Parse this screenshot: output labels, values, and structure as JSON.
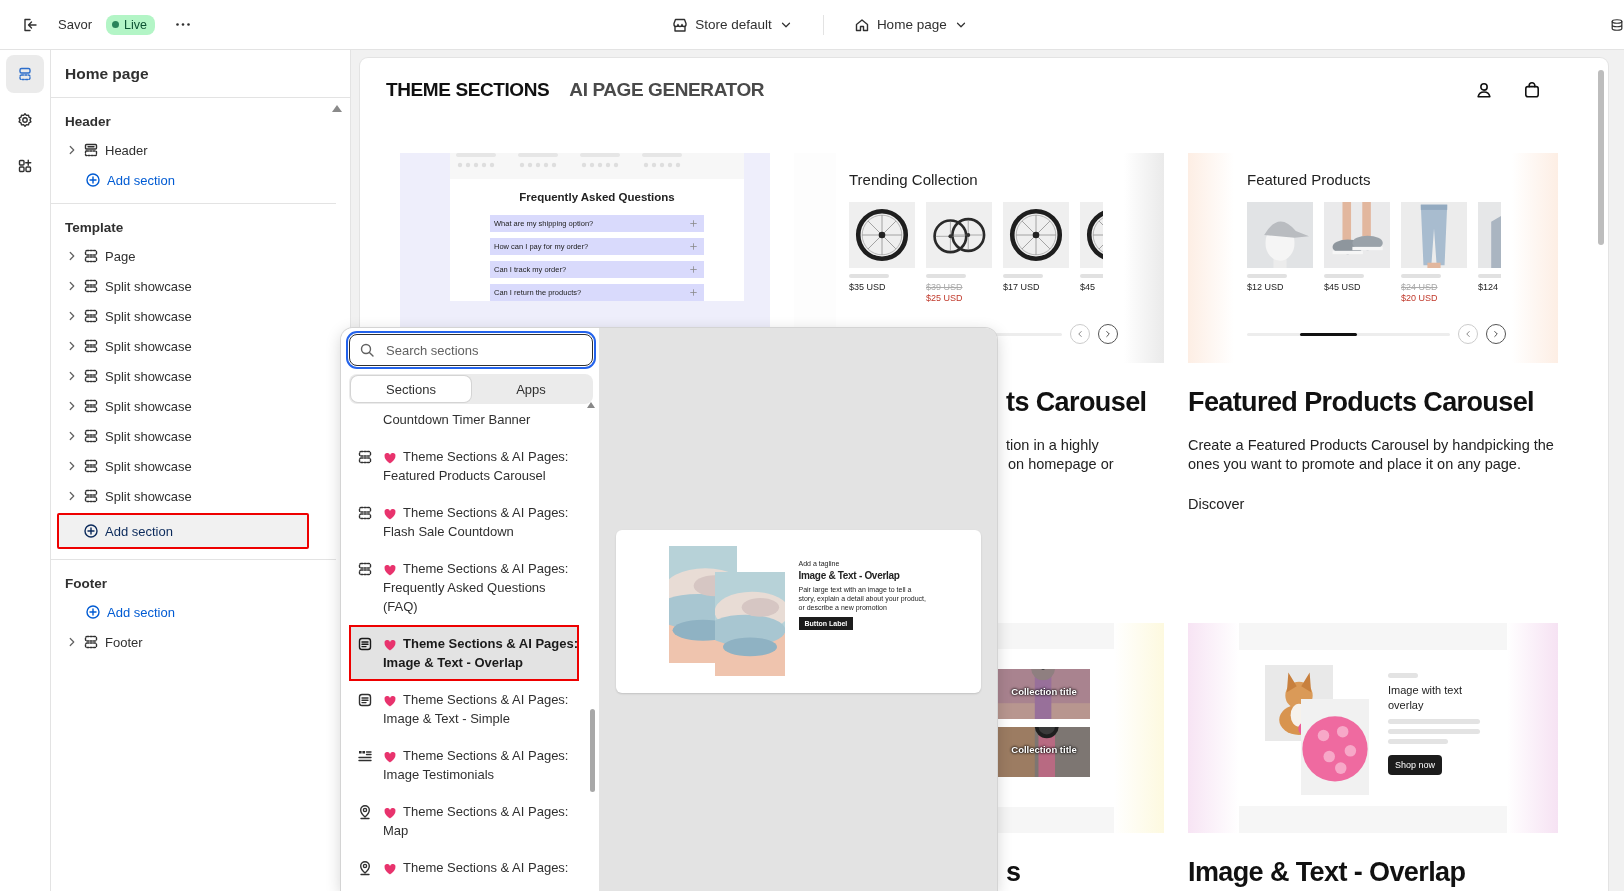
{
  "topbar": {
    "store": "Savor",
    "status": "Live",
    "store_selector": "Store default",
    "page_selector": "Home page"
  },
  "rail": [
    {
      "kind": "sections",
      "selected": true
    },
    {
      "kind": "settings",
      "selected": false
    },
    {
      "kind": "apps",
      "selected": false
    }
  ],
  "sidebar": {
    "title": "Home page",
    "groups": [
      {
        "heading": "Header",
        "entries": [
          {
            "kind": "header",
            "label": "Header",
            "expanded": false
          },
          {
            "kind": "add",
            "label": "Add section",
            "highlighted": false
          }
        ]
      },
      {
        "heading": "Template",
        "entries": [
          {
            "kind": "section",
            "label": "Page",
            "expanded": false
          },
          {
            "kind": "section",
            "label": "Split showcase",
            "expanded": false
          },
          {
            "kind": "section",
            "label": "Split showcase",
            "expanded": false
          },
          {
            "kind": "section",
            "label": "Split showcase",
            "expanded": false
          },
          {
            "kind": "section",
            "label": "Split showcase",
            "expanded": false
          },
          {
            "kind": "section",
            "label": "Split showcase",
            "expanded": false
          },
          {
            "kind": "section",
            "label": "Split showcase",
            "expanded": false
          },
          {
            "kind": "section",
            "label": "Split showcase",
            "expanded": false
          },
          {
            "kind": "section",
            "label": "Split showcase",
            "expanded": false
          },
          {
            "kind": "add",
            "label": "Add section",
            "highlighted": true
          }
        ]
      },
      {
        "heading": "Footer",
        "entries": [
          {
            "kind": "add",
            "label": "Add section",
            "highlighted": false
          },
          {
            "kind": "section",
            "label": "Footer",
            "expanded": false
          }
        ]
      }
    ]
  },
  "preview": {
    "tabs": [
      {
        "label": "THEME SECTIONS",
        "selected": true
      },
      {
        "label": "AI PAGE GENERATOR",
        "selected": false
      }
    ],
    "cards": [
      {
        "kind": "faq",
        "heading": "Frequently Asked Questions",
        "questions": [
          "What are my shipping option?",
          "How can I pay for my order?",
          "Can I track my order?",
          "Can I return the products?"
        ]
      },
      {
        "kind": "carousel",
        "heading": "Trending Collection",
        "products": [
          {
            "price": "$35 USD"
          },
          {
            "old_price": "$39 USD",
            "price": "$25 USD"
          },
          {
            "price": "$17 USD"
          },
          {
            "price": "$45"
          }
        ],
        "title": "ts Carousel",
        "fragments": [
          "tion in a highly",
          "on homepage or"
        ]
      },
      {
        "kind": "carousel",
        "heading": "Featured Products",
        "products": [
          {
            "price": "$12 USD"
          },
          {
            "price": "$45 USD"
          },
          {
            "old_price": "$24 USD",
            "price": "$20 USD"
          },
          {
            "price": "$124"
          }
        ],
        "title": "Featured Products Carousel",
        "description": "Create a Featured Products Carousel by handpicking the ones you want to promote and place it on any page.",
        "link": "Discover"
      },
      {
        "kind": "collections",
        "labels": [
          "Collection title",
          "Collection title"
        ],
        "title": "s"
      },
      {
        "kind": "overlap",
        "heading": "Image with text overlay",
        "button": "Shop now",
        "title": "Image & Text - Overlap"
      }
    ]
  },
  "popup": {
    "search": {
      "placeholder": "Search sections"
    },
    "tabs": [
      {
        "label": "Sections",
        "selected": true
      },
      {
        "label": "Apps",
        "selected": false
      }
    ],
    "items": [
      {
        "subtitle": "Countdown Timer Banner",
        "selected": false,
        "highlighted": false
      },
      {
        "kind": "section",
        "title": "Theme Sections & AI Pages:",
        "subtitle": "Featured Products Carousel",
        "selected": false,
        "highlighted": false
      },
      {
        "kind": "section",
        "title": "Theme Sections & AI Pages:",
        "subtitle": "Flash Sale Countdown",
        "selected": false,
        "highlighted": false
      },
      {
        "kind": "section",
        "title": "Theme Sections & AI Pages:",
        "subtitle": "Frequently Asked Questions (FAQ)",
        "selected": false,
        "highlighted": false
      },
      {
        "kind": "text",
        "title": "Theme Sections & AI Pages:",
        "subtitle": "Image & Text - Overlap",
        "selected": true,
        "highlighted": true
      },
      {
        "kind": "text",
        "title": "Theme Sections & AI Pages:",
        "subtitle": "Image & Text - Simple",
        "selected": false,
        "highlighted": false
      },
      {
        "kind": "testimonial",
        "title": "Theme Sections & AI Pages:",
        "subtitle": "Image Testimonials",
        "selected": false,
        "highlighted": false
      },
      {
        "kind": "map",
        "title": "Theme Sections & AI Pages:",
        "subtitle": "Map",
        "selected": false,
        "highlighted": false
      },
      {
        "kind": "map",
        "title": "Theme Sections & AI Pages:",
        "selected": false,
        "highlighted": false
      }
    ],
    "preview": {
      "tagline": "Add a tagline",
      "heading": "Image & Text - Overlap",
      "text": "Pair large text with an image to tell a story, explain a detail about your product, or describe a new promotion",
      "button": "Button Label"
    }
  }
}
